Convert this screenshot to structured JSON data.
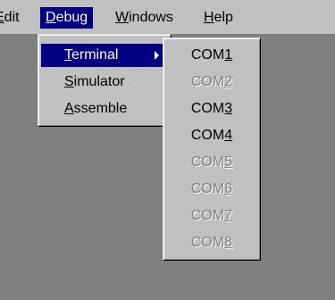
{
  "menubar": {
    "edit": {
      "pre": "",
      "ul": "E",
      "post": "dit"
    },
    "debug": {
      "pre": "",
      "ul": "D",
      "post": "ebug"
    },
    "windows": {
      "pre": "",
      "ul": "W",
      "post": "indows"
    },
    "help": {
      "pre": "",
      "ul": "H",
      "post": "elp"
    }
  },
  "debug_menu": {
    "terminal": {
      "pre": "",
      "ul": "T",
      "post": "erminal"
    },
    "simulator": {
      "pre": "",
      "ul": "S",
      "post": "imulator"
    },
    "assemble": {
      "pre": "",
      "ul": "A",
      "post": "ssemble"
    }
  },
  "terminal_submenu": {
    "com1": {
      "pre": "COM",
      "ul": "1",
      "enabled": true
    },
    "com2": {
      "pre": "COM",
      "ul": "2",
      "enabled": false
    },
    "com3": {
      "pre": "COM",
      "ul": "3",
      "enabled": true
    },
    "com4": {
      "pre": "COM",
      "ul": "4",
      "enabled": true
    },
    "com5": {
      "pre": "COM",
      "ul": "5",
      "enabled": false
    },
    "com6": {
      "pre": "COM",
      "ul": "6",
      "enabled": false
    },
    "com7": {
      "pre": "COM",
      "ul": "7",
      "enabled": false
    },
    "com8": {
      "pre": "COM",
      "ul": "8",
      "enabled": false
    }
  }
}
